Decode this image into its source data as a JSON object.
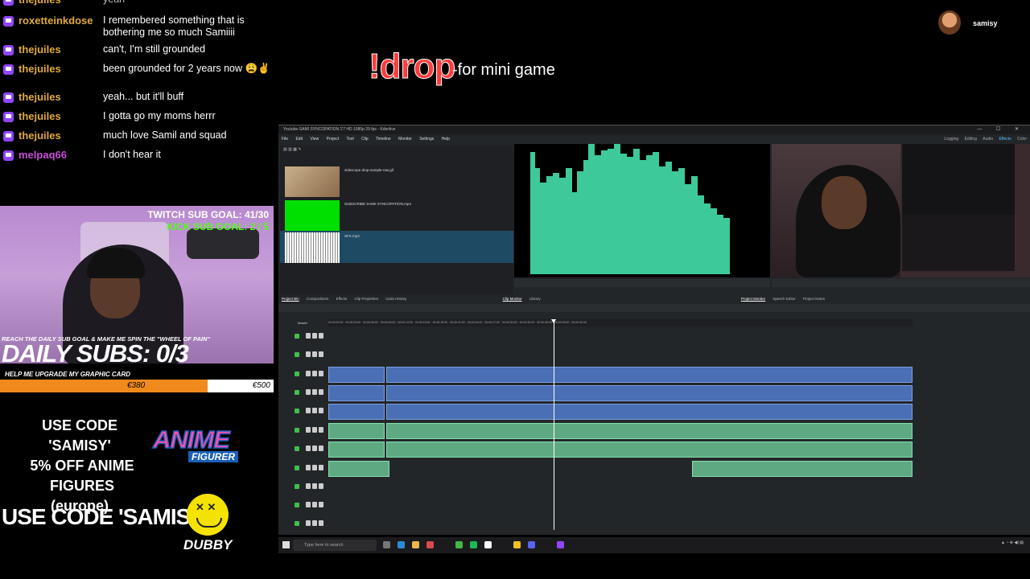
{
  "chat": {
    "messages": [
      {
        "user": "thejuiles",
        "text": "yeah",
        "color": "#e0a93a"
      },
      {
        "user": "roxetteinkdose",
        "text": "I remembered something that is bothering me so much Samiiii",
        "color": "#e0a93a"
      },
      {
        "user": "thejuiles",
        "text": "can't, I'm still grounded",
        "color": "#e0a93a"
      },
      {
        "user": "thejuiles",
        "text": "been grounded for 2 years now 😩✌",
        "color": "#e0a93a"
      },
      {
        "user": "thejuiles",
        "text": "yeah... but it'll buff",
        "color": "#e0a93a"
      },
      {
        "user": "thejuiles",
        "text": "I gotta go my moms herrr",
        "color": "#e0a93a"
      },
      {
        "user": "thejuiles",
        "text": "much love Samil and squad",
        "color": "#e0a93a"
      },
      {
        "user": "melpaq66",
        "text": "I don't hear it",
        "color": "#c44fd6"
      }
    ]
  },
  "banner": {
    "command": "!drop",
    "description": "-for mini game"
  },
  "streamer": {
    "name": "samisy"
  },
  "overlay": {
    "twitch_goal": "TWITCH SUB GOAL: 41/30",
    "kick_goal": "KICK SUB GOAL: 2 / 5",
    "reach_text": "REACH THE DAILY SUB GOAL & MAKE ME SPIN THE \"WHEEL OF PAIN\"",
    "daily_subs": "DAILY SUBS: 0/3",
    "upgrade_text": "HELP ME UPGRADE MY GRAPHIC CARD",
    "gpu_current": "€380",
    "gpu_target": "€500",
    "gpu_progress": 0.76,
    "code_line1": "USE CODE 'SAMISY'",
    "code_line2": "5% OFF ANIME FIGURES",
    "code_line3": "(europe)",
    "anime_brand": "ANIME",
    "anime_sub": "FIGURER",
    "code_dubby": "USE CODE 'SAMISY'",
    "dubby_brand": "DUBBY"
  },
  "editor": {
    "title": "Youtube-SAMI SYNCOPATION 1'7 HD 1080p 29 fps - Kdenlive",
    "menu": [
      "File",
      "Edit",
      "View",
      "Project",
      "Tool",
      "Clip",
      "Timeline",
      "Monitor",
      "Settings",
      "Help"
    ],
    "workspaces": [
      "Logging",
      "Editing",
      "Audio",
      "Effects",
      "Color"
    ],
    "active_workspace": "Effects",
    "bin_items": [
      {
        "name": "sidescope drop-sample-raw.gif"
      },
      {
        "name": "SUBSCRIBE SAMII SYNCOPATION.mp4"
      },
      {
        "name": "SFX.mp3"
      }
    ],
    "bottom_tabs": [
      "Project Bin",
      "Compositions",
      "Effects",
      "Clip Properties",
      "Undo History",
      "Clip Monitor",
      "Library",
      "Project Monitor",
      "Speech Editor",
      "Project Notes"
    ],
    "track_label": "Master",
    "taskbar_search": "Type here to search"
  },
  "colors": {
    "accent_twitch": "#9146ff",
    "kick_green": "#53fc18",
    "clip_video": "#4a6fb5",
    "clip_audio": "#5fa982"
  }
}
